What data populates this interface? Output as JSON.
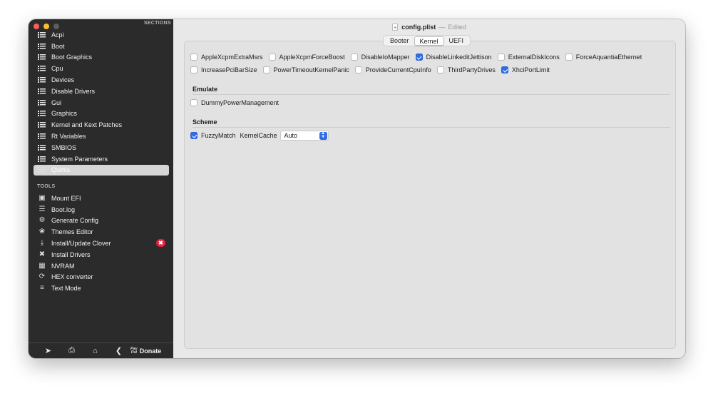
{
  "window": {
    "filename": "config.plist",
    "separator": "—",
    "status": "Edited"
  },
  "sidebar": {
    "sections_header": "SECTIONS",
    "sections": [
      {
        "label": "Acpi"
      },
      {
        "label": "Boot"
      },
      {
        "label": "Boot Graphics"
      },
      {
        "label": "Cpu"
      },
      {
        "label": "Devices"
      },
      {
        "label": "Disable Drivers"
      },
      {
        "label": "Gui"
      },
      {
        "label": "Graphics"
      },
      {
        "label": "Kernel and Kext Patches"
      },
      {
        "label": "Rt Variables"
      },
      {
        "label": "SMBIOS"
      },
      {
        "label": "System Parameters"
      },
      {
        "label": "Quirks",
        "selected": true
      }
    ],
    "tools_header": "TOOLS",
    "tools": [
      {
        "label": "Mount EFI",
        "icon": "disk-icon"
      },
      {
        "label": "Boot.log",
        "icon": "log-icon"
      },
      {
        "label": "Generate Config",
        "icon": "gears-icon"
      },
      {
        "label": "Themes Editor",
        "icon": "palette-icon"
      },
      {
        "label": "Install/Update Clover",
        "icon": "download-icon",
        "badge": "✖"
      },
      {
        "label": "Install Drivers",
        "icon": "tools-icon"
      },
      {
        "label": "NVRAM",
        "icon": "chip-icon"
      },
      {
        "label": "HEX converter",
        "icon": "refresh-icon"
      },
      {
        "label": "Text Mode",
        "icon": "text-icon"
      }
    ],
    "bottom": {
      "paypal_line1": "Pay",
      "paypal_line2": "Pal",
      "donate": "Donate"
    }
  },
  "tabs": [
    {
      "label": "Booter"
    },
    {
      "label": "Kernel",
      "active": true
    },
    {
      "label": "UEFI"
    }
  ],
  "kernel": {
    "row1": [
      {
        "label": "AppleXcpmExtraMsrs",
        "checked": false
      },
      {
        "label": "AppleXcpmForceBoost",
        "checked": false
      },
      {
        "label": "DisableIoMapper",
        "checked": false
      },
      {
        "label": "DisableLinkeditJettison",
        "checked": true
      },
      {
        "label": "ExternalDiskIcons",
        "checked": false
      },
      {
        "label": "ForceAquantiaEthernet",
        "checked": false
      }
    ],
    "row2": [
      {
        "label": "IncreasePciBarSize",
        "checked": false
      },
      {
        "label": "PowerTimeoutKernelPanic",
        "checked": false
      },
      {
        "label": "ProvideCurrentCpuInfo",
        "checked": false
      },
      {
        "label": "ThirdPartyDrives",
        "checked": false
      },
      {
        "label": "XhciPortLimit",
        "checked": true
      }
    ],
    "emulate_title": "Emulate",
    "emulate": [
      {
        "label": "DummyPowerManagement",
        "checked": false
      }
    ],
    "scheme_title": "Scheme",
    "scheme_fuzzy": {
      "label": "FuzzyMatch",
      "checked": true
    },
    "scheme_kernelcache_label": "KernelCache",
    "scheme_kernelcache_value": "Auto"
  },
  "colors": {
    "accent": "#2f6ce6",
    "sidebar_bg": "#2b2b2b",
    "badge": "#e0233f"
  }
}
